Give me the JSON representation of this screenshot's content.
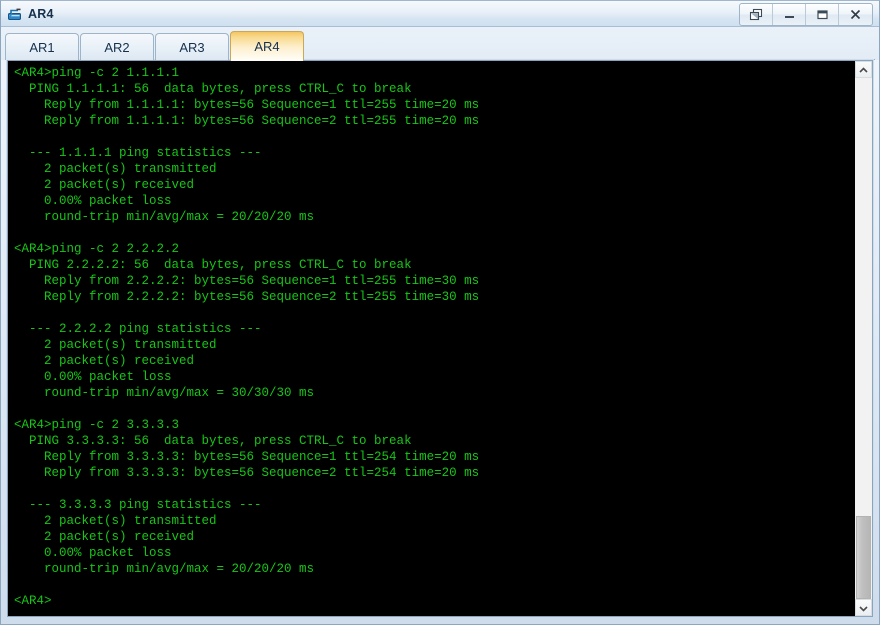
{
  "window": {
    "title": "AR4",
    "icon": "router-icon",
    "controls": [
      {
        "name": "restore-button",
        "label": "Restore"
      },
      {
        "name": "minimize-button",
        "label": "Minimize"
      },
      {
        "name": "maximize-button",
        "label": "Maximize"
      },
      {
        "name": "close-button",
        "label": "X"
      }
    ]
  },
  "tabs": [
    {
      "label": "AR1",
      "active": false
    },
    {
      "label": "AR2",
      "active": false
    },
    {
      "label": "AR3",
      "active": false
    },
    {
      "label": "AR4",
      "active": true
    }
  ],
  "terminal": {
    "foreground": "#16c716",
    "background": "#000000",
    "prompt": "<AR4>",
    "lines": [
      "<AR4>ping -c 2 1.1.1.1",
      "  PING 1.1.1.1: 56  data bytes, press CTRL_C to break",
      "    Reply from 1.1.1.1: bytes=56 Sequence=1 ttl=255 time=20 ms",
      "    Reply from 1.1.1.1: bytes=56 Sequence=2 ttl=255 time=20 ms",
      "",
      "  --- 1.1.1.1 ping statistics ---",
      "    2 packet(s) transmitted",
      "    2 packet(s) received",
      "    0.00% packet loss",
      "    round-trip min/avg/max = 20/20/20 ms",
      "",
      "<AR4>ping -c 2 2.2.2.2",
      "  PING 2.2.2.2: 56  data bytes, press CTRL_C to break",
      "    Reply from 2.2.2.2: bytes=56 Sequence=1 ttl=255 time=30 ms",
      "    Reply from 2.2.2.2: bytes=56 Sequence=2 ttl=255 time=30 ms",
      "",
      "  --- 2.2.2.2 ping statistics ---",
      "    2 packet(s) transmitted",
      "    2 packet(s) received",
      "    0.00% packet loss",
      "    round-trip min/avg/max = 30/30/30 ms",
      "",
      "<AR4>ping -c 2 3.3.3.3",
      "  PING 3.3.3.3: 56  data bytes, press CTRL_C to break",
      "    Reply from 3.3.3.3: bytes=56 Sequence=1 ttl=254 time=20 ms",
      "    Reply from 3.3.3.3: bytes=56 Sequence=2 ttl=254 time=20 ms",
      "",
      "  --- 3.3.3.3 ping statistics ---",
      "    2 packet(s) transmitted",
      "    2 packet(s) received",
      "    0.00% packet loss",
      "    round-trip min/avg/max = 20/20/20 ms",
      "",
      "<AR4>"
    ]
  },
  "scrollbar": {
    "up_arrow": "chevron-up-icon",
    "down_arrow": "chevron-down-icon",
    "thumb_top_pct": 84,
    "thumb_height_pct": 16
  }
}
